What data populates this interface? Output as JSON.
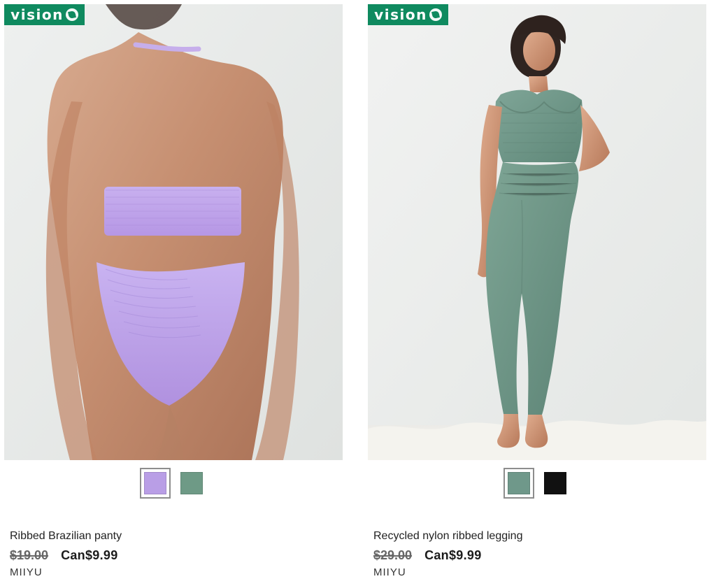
{
  "products": [
    {
      "badge_text": "vision",
      "name": "Ribbed Brazilian panty",
      "old_price": "$19.00",
      "new_price": "Can$9.99",
      "brand": "MIIYU",
      "swatches": [
        {
          "label": "lilac",
          "color": "#b99ee6",
          "selected": true
        },
        {
          "label": "sage green",
          "color": "#6e9a86",
          "selected": false
        }
      ]
    },
    {
      "badge_text": "vision",
      "name": "Recycled nylon ribbed legging",
      "old_price": "$29.00",
      "new_price": "Can$9.99",
      "brand": "MIIYU",
      "swatches": [
        {
          "label": "sage green",
          "color": "#6f988a",
          "selected": true
        },
        {
          "label": "black",
          "color": "#111111",
          "selected": false
        }
      ]
    }
  ],
  "colors": {
    "vision_badge": "#0f8a5f",
    "lilac": "#b99ee6",
    "sage": "#6f988a",
    "black": "#111111"
  },
  "icons": {
    "badge_leaf": "leaf-icon"
  }
}
